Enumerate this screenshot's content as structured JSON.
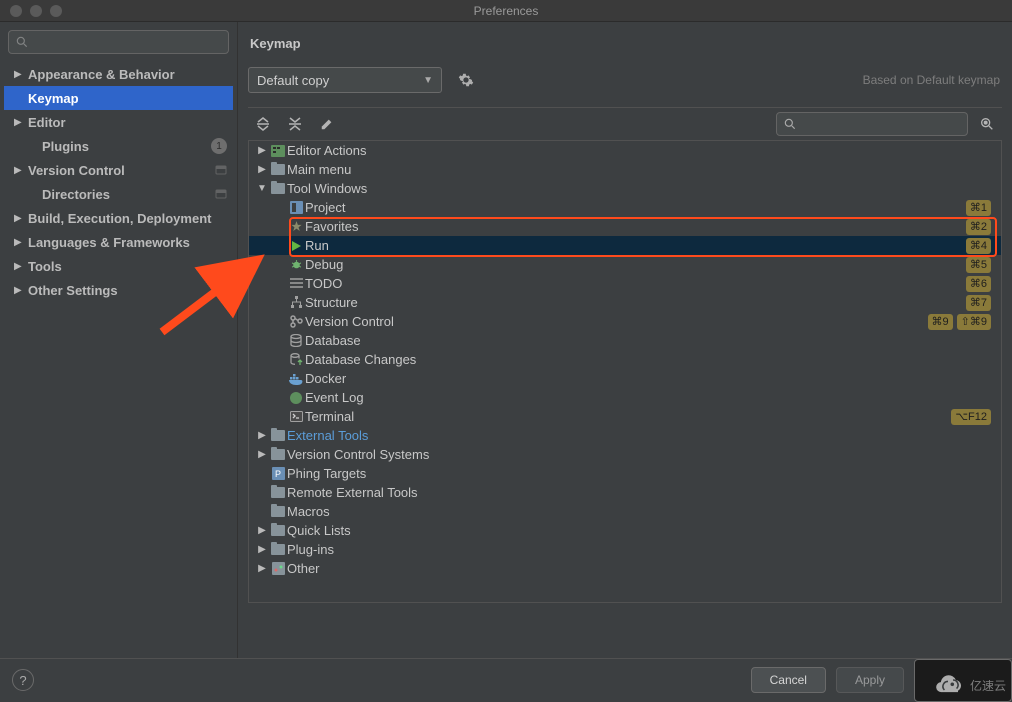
{
  "titlebar": {
    "title": "Preferences"
  },
  "sidebar": {
    "items": [
      {
        "label": "Appearance & Behavior",
        "expandable": true
      },
      {
        "label": "Keymap",
        "expandable": false,
        "selected": true
      },
      {
        "label": "Editor",
        "expandable": true
      },
      {
        "label": "Plugins",
        "expandable": false,
        "badge": "1"
      },
      {
        "label": "Version Control",
        "expandable": true,
        "meta": true
      },
      {
        "label": "Directories",
        "expandable": false,
        "meta": true
      },
      {
        "label": "Build, Execution, Deployment",
        "expandable": true
      },
      {
        "label": "Languages & Frameworks",
        "expandable": true
      },
      {
        "label": "Tools",
        "expandable": true
      },
      {
        "label": "Other Settings",
        "expandable": true
      }
    ]
  },
  "content": {
    "title": "Keymap",
    "dropdown": "Default copy",
    "based": "Based on Default keymap",
    "tree": [
      {
        "label": "Editor Actions",
        "depth": 0,
        "tri": "right",
        "icon": "actions"
      },
      {
        "label": "Main menu",
        "depth": 0,
        "tri": "right",
        "icon": "folder"
      },
      {
        "label": "Tool Windows",
        "depth": 0,
        "tri": "down",
        "icon": "folder"
      },
      {
        "label": "Project",
        "depth": 1,
        "icon": "project",
        "shortcut": [
          "⌘1"
        ]
      },
      {
        "label": "Favorites",
        "depth": 1,
        "icon": "star",
        "shortcut": [
          "⌘2"
        ]
      },
      {
        "label": "Run",
        "depth": 1,
        "icon": "run",
        "shortcut": [
          "⌘4"
        ],
        "selected": true
      },
      {
        "label": "Debug",
        "depth": 1,
        "icon": "debug",
        "shortcut": [
          "⌘5"
        ]
      },
      {
        "label": "TODO",
        "depth": 1,
        "icon": "todo",
        "shortcut": [
          "⌘6"
        ]
      },
      {
        "label": "Structure",
        "depth": 1,
        "icon": "structure",
        "shortcut": [
          "⌘7"
        ]
      },
      {
        "label": "Version Control",
        "depth": 1,
        "icon": "vcs",
        "shortcut": [
          "⌘9",
          "⇧⌘9"
        ]
      },
      {
        "label": "Database",
        "depth": 1,
        "icon": "database"
      },
      {
        "label": "Database Changes",
        "depth": 1,
        "icon": "dbchanges"
      },
      {
        "label": "Docker",
        "depth": 1,
        "icon": "docker"
      },
      {
        "label": "Event Log",
        "depth": 1,
        "icon": "eventlog"
      },
      {
        "label": "Terminal",
        "depth": 1,
        "icon": "terminal",
        "shortcut": [
          "⌥F12"
        ]
      },
      {
        "label": "External Tools",
        "depth": 0,
        "tri": "right",
        "icon": "folder",
        "link": true
      },
      {
        "label": "Version Control Systems",
        "depth": 0,
        "tri": "right",
        "icon": "folder"
      },
      {
        "label": "Phing Targets",
        "depth": 0,
        "icon": "phing"
      },
      {
        "label": "Remote External Tools",
        "depth": 0,
        "icon": "folder"
      },
      {
        "label": "Macros",
        "depth": 0,
        "icon": "folder"
      },
      {
        "label": "Quick Lists",
        "depth": 0,
        "tri": "right",
        "icon": "folder"
      },
      {
        "label": "Plug-ins",
        "depth": 0,
        "tri": "right",
        "icon": "folder"
      },
      {
        "label": "Other",
        "depth": 0,
        "tri": "right",
        "icon": "other"
      }
    ]
  },
  "footer": {
    "cancel": "Cancel",
    "apply": "Apply"
  },
  "watermark": "亿速云"
}
